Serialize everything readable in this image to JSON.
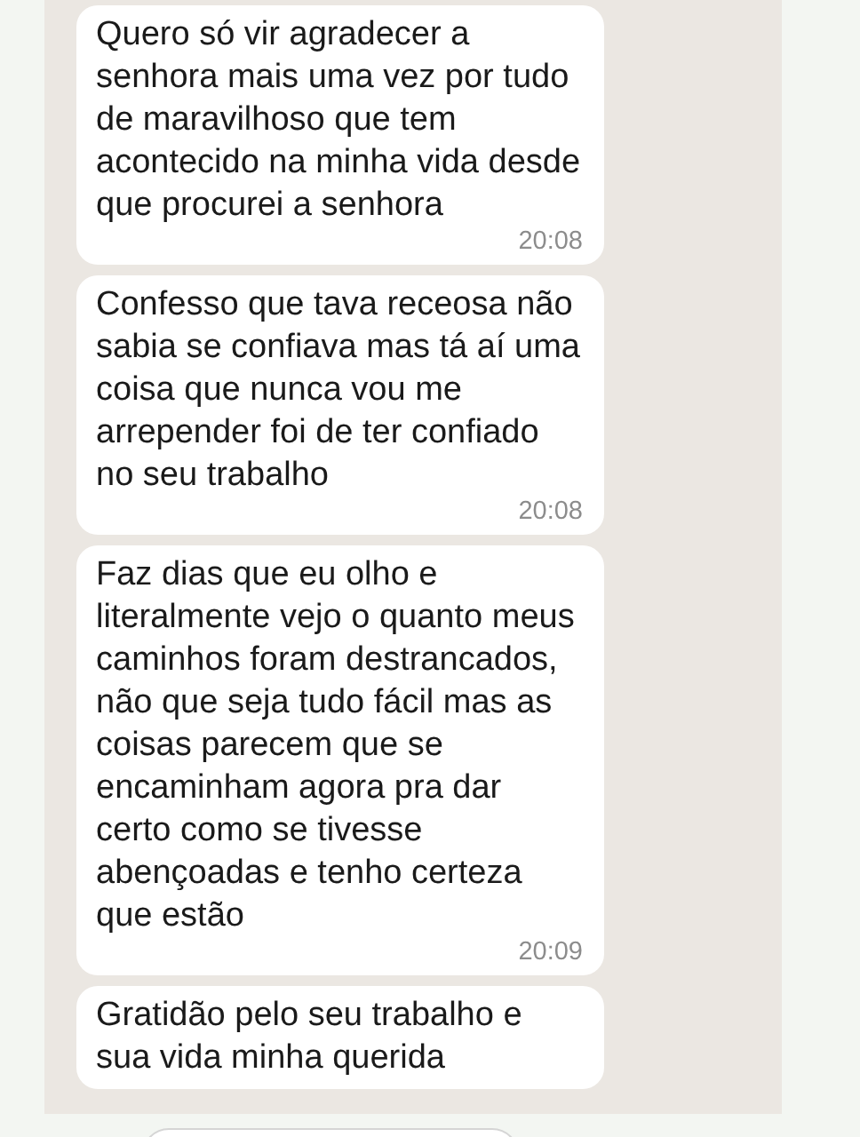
{
  "messages": [
    {
      "text": "Quero só vir agradecer a senhora mais uma vez por tudo de maravilhoso que tem acontecido na minha vida desde que procurei a senhora",
      "time": "20:08"
    },
    {
      "text": "Confesso que tava receosa não sabia se confiava mas tá aí uma coisa que nunca vou me arrepender foi de ter confiado no seu trabalho",
      "time": "20:08"
    },
    {
      "text": "Faz dias que eu olho e literalmente vejo o quanto meus caminhos foram destrancados, não que seja tudo fácil mas as coisas parecem que se encaminham agora pra dar certo como se tivesse abençoadas e tenho certeza que estão",
      "time": "20:09"
    },
    {
      "text": "Gratidão pelo seu trabalho e sua vida minha querida"
    }
  ]
}
